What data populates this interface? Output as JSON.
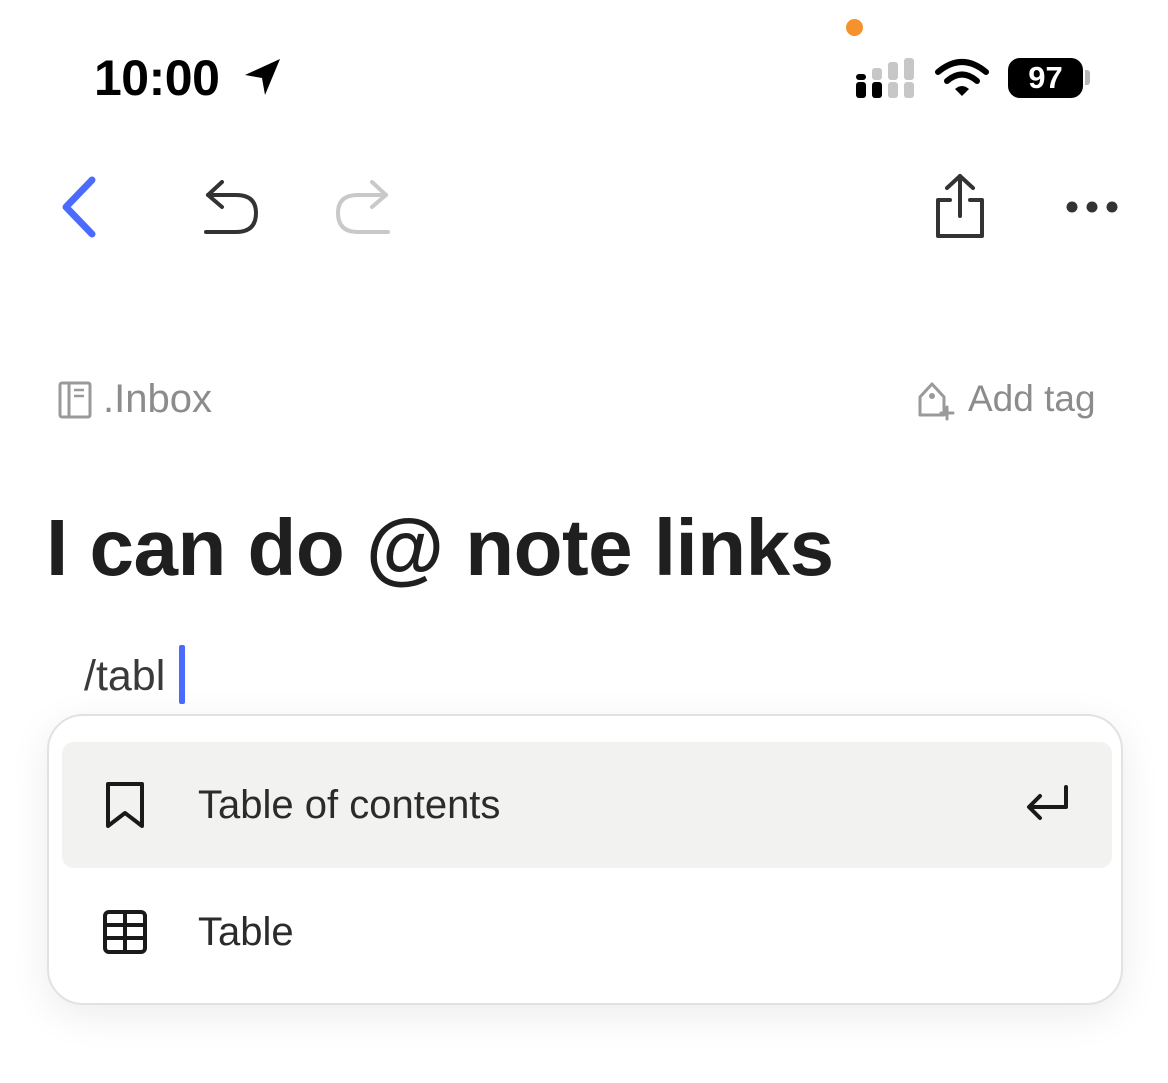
{
  "status_bar": {
    "time": "10:00",
    "battery_level": "97"
  },
  "toolbar": {
    "back": "back-chevron-icon",
    "undo": "undo-icon",
    "redo": "redo-icon",
    "share": "share-icon",
    "more": "more-icon"
  },
  "note": {
    "notebook": ".Inbox",
    "add_tag_label": "Add tag",
    "title": "I can do @ note links",
    "typed_command": "/tabl"
  },
  "command_menu": {
    "items": [
      {
        "label": "Table of contents",
        "icon": "bookmark-icon",
        "selected": true
      },
      {
        "label": "Table",
        "icon": "table-icon",
        "selected": false
      }
    ]
  },
  "colors": {
    "accent": "#4b6bff",
    "selected_item_bg": "#f2f2f1",
    "camera_indicator": "#f5922e"
  }
}
